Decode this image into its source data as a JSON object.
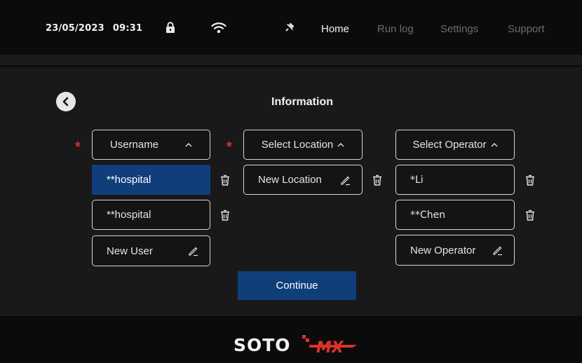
{
  "status_bar": {
    "date": "23/05/2023",
    "time": "09:31",
    "icons": [
      "lock-icon",
      "wifi-icon",
      "bell-icon"
    ]
  },
  "nav": {
    "items": [
      {
        "label": "Home",
        "active": true
      },
      {
        "label": "Run log",
        "active": false
      },
      {
        "label": "Settings",
        "active": false
      },
      {
        "label": "Support",
        "active": false
      }
    ]
  },
  "page": {
    "title": "Information",
    "back_icon": "chevron-left-icon",
    "required_mark": "*"
  },
  "users": {
    "header": "Username",
    "caret": "^",
    "items": [
      "**hospital",
      "**hospital"
    ],
    "selected_index": 0,
    "new_label": "New User"
  },
  "locations": {
    "header": "Select Location",
    "caret": "^",
    "new_label": "New Location"
  },
  "operators": {
    "header": "Select Operator",
    "caret": "^",
    "items": [
      "*Li",
      "**Chen"
    ],
    "new_label": "New Operator"
  },
  "actions": {
    "continue_label": "Continue"
  },
  "footer": {
    "logo_text": "SOTO",
    "logo_suffix": "MX"
  },
  "colors": {
    "accent": "#0f3e7a",
    "required": "#e0302a",
    "logo_red": "#e0302a"
  }
}
